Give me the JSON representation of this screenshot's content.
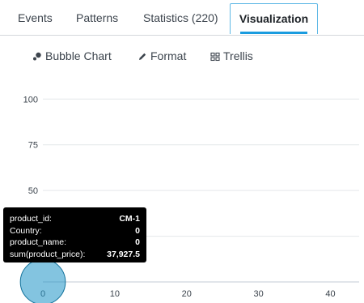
{
  "tabs": [
    {
      "label": "Events",
      "active": false
    },
    {
      "label": "Patterns",
      "active": false
    },
    {
      "label": "Statistics (220)",
      "active": false
    },
    {
      "label": "Visualization",
      "active": true
    }
  ],
  "toolbar": {
    "chart_type_label": "Bubble Chart",
    "format_label": "Format",
    "trellis_label": "Trellis"
  },
  "chart_data": {
    "type": "scatter",
    "title": "",
    "xlabel": "",
    "ylabel": "product_name",
    "x_ticks": [
      "0",
      "10",
      "20",
      "30",
      "40"
    ],
    "y_ticks": [
      "100",
      "75",
      "50",
      "25"
    ],
    "xlim": [
      0,
      44
    ],
    "ylim": [
      0,
      105
    ],
    "series": [
      {
        "points": [
          {
            "x": 0,
            "y": 0,
            "size": 37927.5
          }
        ]
      }
    ],
    "bubble_color": "#1e93c6"
  },
  "tooltip": {
    "rows": [
      {
        "key": "product_id:",
        "value": "CM-1"
      },
      {
        "key": "Country:",
        "value": "0"
      },
      {
        "key": "product_name:",
        "value": "0"
      },
      {
        "key": "sum(product_price):",
        "value": "37,927.5"
      }
    ]
  }
}
